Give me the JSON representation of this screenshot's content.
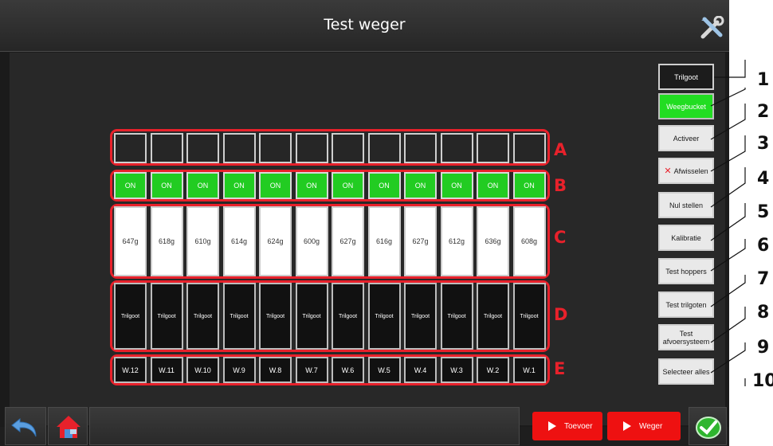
{
  "header": {
    "title": "Test weger"
  },
  "rows": {
    "a_label": "A",
    "b_label": "B",
    "c_label": "C",
    "d_label": "D",
    "e_label": "E",
    "status": [
      "ON",
      "ON",
      "ON",
      "ON",
      "ON",
      "ON",
      "ON",
      "ON",
      "ON",
      "ON",
      "ON",
      "ON"
    ],
    "weights": [
      "647g",
      "618g",
      "610g",
      "614g",
      "624g",
      "600g",
      "627g",
      "616g",
      "627g",
      "612g",
      "636g",
      "608g"
    ],
    "feeders": [
      "Trilgoot",
      "Trilgoot",
      "Trilgoot",
      "Trilgoot",
      "Trilgoot",
      "Trilgoot",
      "Trilgoot",
      "Trilgoot",
      "Trilgoot",
      "Trilgoot",
      "Trilgoot",
      "Trilgoot"
    ],
    "weigher_ids": [
      "W.12",
      "W.11",
      "W.10",
      "W.9",
      "W.8",
      "W.7",
      "W.6",
      "W.5",
      "W.4",
      "W.3",
      "W.2",
      "W.1"
    ]
  },
  "side_panel": {
    "trilgoot": "Trilgoot",
    "weegbucket": "Weegbucket",
    "activeer": "Activeer",
    "afwisselen": "Afwisselen",
    "nul_stellen": "Nul stellen",
    "kalibratie": "Kalibratie",
    "test_hoppers": "Test hoppers",
    "test_trilgoten": "Test trilgoten",
    "test_afvoersysteem_1": "Test",
    "test_afvoersysteem_2": "afvoersysteem",
    "selecteer_alles": "Selecteer alles"
  },
  "callouts": [
    "1",
    "2",
    "3",
    "4",
    "5",
    "6",
    "7",
    "8",
    "9",
    "10"
  ],
  "footer": {
    "toevoer": "Toevoer",
    "weger": "Weger"
  },
  "icons": {
    "tools": "tools-icon",
    "back": "back-arrow-icon",
    "home": "home-icon",
    "confirm": "checkmark-icon"
  },
  "colors": {
    "active_green": "#22cc22",
    "highlight_red": "#e8212b",
    "action_red": "#ee1111"
  }
}
